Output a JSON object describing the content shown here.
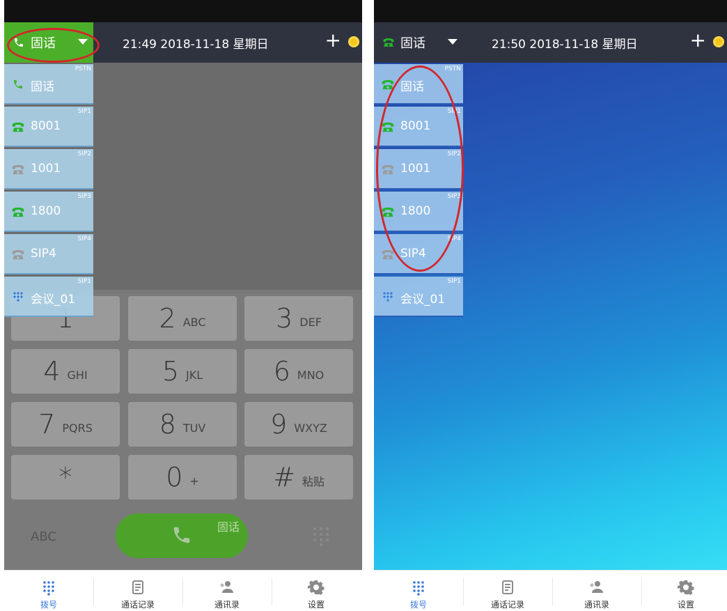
{
  "left": {
    "account_label": "固话",
    "datetime": "21:49  2018-11-18 星期日",
    "accounts": [
      {
        "type": "PSTN",
        "name": "固话",
        "icon": "handset-icon",
        "color": "#3fb82a"
      },
      {
        "type": "SIP1",
        "name": "8001",
        "icon": "phone-icon",
        "color": "#22b52a"
      },
      {
        "type": "SIP2",
        "name": "1001",
        "icon": "phone-icon",
        "color": "#9b9b9b"
      },
      {
        "type": "SIP3",
        "name": "1800",
        "icon": "phone-icon",
        "color": "#22b52a"
      },
      {
        "type": "SIP4",
        "name": "SIP4",
        "icon": "phone-icon",
        "color": "#9b9b9b"
      },
      {
        "type": "SIP1",
        "name": "会议_01",
        "icon": "conference-icon",
        "color": "#2f7ad9"
      }
    ],
    "keys": [
      {
        "digit": "1",
        "sub": ""
      },
      {
        "digit": "2",
        "sub": "ABC"
      },
      {
        "digit": "3",
        "sub": "DEF"
      },
      {
        "digit": "4",
        "sub": "GHI"
      },
      {
        "digit": "5",
        "sub": "JKL"
      },
      {
        "digit": "6",
        "sub": "MNO"
      },
      {
        "digit": "7",
        "sub": "PQRS"
      },
      {
        "digit": "8",
        "sub": "TUV"
      },
      {
        "digit": "9",
        "sub": "WXYZ"
      },
      {
        "digit": "*",
        "sub": ""
      },
      {
        "digit": "0",
        "sub": "+"
      },
      {
        "digit": "#",
        "sub": "粘贴"
      }
    ],
    "abc_label": "ABC",
    "call_label": "固话"
  },
  "right": {
    "account_label": "固话",
    "datetime": "21:50  2018-11-18 星期日",
    "accounts": [
      {
        "type": "PSTN",
        "name": "固话",
        "icon": "phone-icon",
        "color": "#22b52a"
      },
      {
        "type": "SIP1",
        "name": "8001",
        "icon": "phone-icon",
        "color": "#22b52a"
      },
      {
        "type": "SIP2",
        "name": "1001",
        "icon": "phone-icon",
        "color": "#9b9b9b"
      },
      {
        "type": "SIP3",
        "name": "1800",
        "icon": "phone-icon",
        "color": "#22b52a"
      },
      {
        "type": "SIP4",
        "name": "SIP4",
        "icon": "phone-icon",
        "color": "#9b9b9b"
      },
      {
        "type": "SIP1",
        "name": "会议_01",
        "icon": "conference-icon",
        "color": "#2f7ad9"
      }
    ]
  },
  "tabs": [
    {
      "label": "拨号",
      "icon": "dialpad-icon",
      "active": true
    },
    {
      "label": "通话记录",
      "icon": "call-log-icon",
      "active": false
    },
    {
      "label": "通讯录",
      "icon": "contacts-icon",
      "active": false
    },
    {
      "label": "设置",
      "icon": "gear-icon",
      "active": false
    }
  ],
  "colors": {
    "accent": "#3b7ad6",
    "call_green": "#4da32a",
    "highlight": "#d3262b"
  }
}
